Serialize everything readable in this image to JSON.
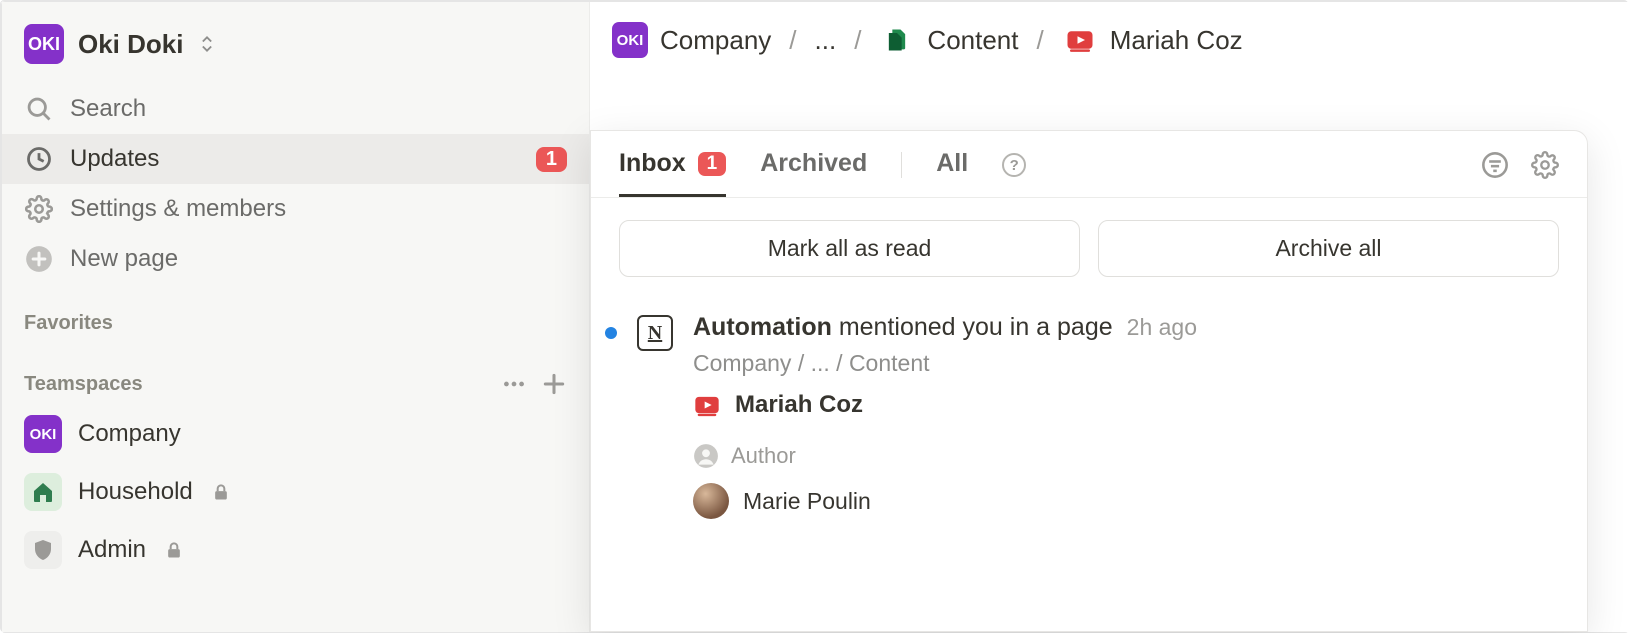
{
  "workspace": {
    "name": "Oki Doki",
    "logo_text": "OKI"
  },
  "sidebar": {
    "search": "Search",
    "updates": "Updates",
    "updates_badge": "1",
    "settings": "Settings & members",
    "new_page": "New page",
    "favorites_label": "Favorites",
    "teamspaces_label": "Teamspaces",
    "teams": [
      {
        "name": "Company",
        "logo_text": "OKI"
      },
      {
        "name": "Household"
      },
      {
        "name": "Admin"
      }
    ]
  },
  "breadcrumb": {
    "items": [
      "Company",
      "...",
      "Content",
      "Mariah Coz"
    ]
  },
  "panel": {
    "tabs": {
      "inbox": "Inbox",
      "inbox_badge": "1",
      "archived": "Archived",
      "all": "All"
    },
    "buttons": {
      "mark_read": "Mark all as read",
      "archive_all": "Archive all"
    },
    "notification": {
      "actor": "Automation",
      "action": "mentioned you in a page",
      "time": "2h ago",
      "breadcrumb": "Company / ... / Content",
      "page": "Mariah Coz",
      "meta_label": "Author",
      "author": "Marie Poulin"
    }
  }
}
